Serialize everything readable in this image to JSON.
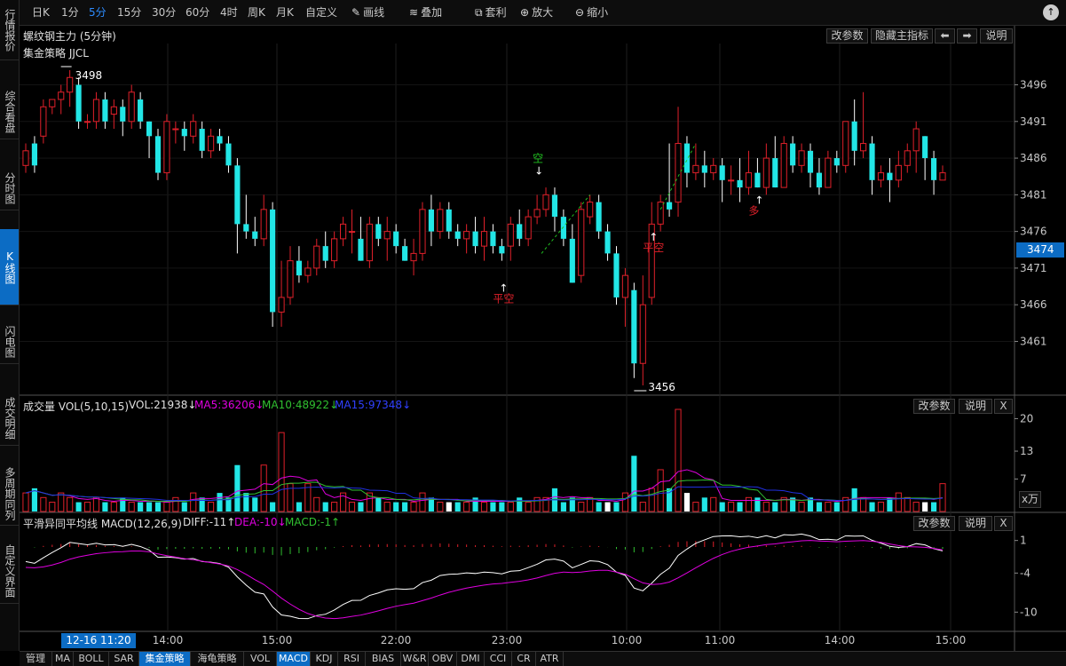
{
  "sidebar": {
    "items": [
      {
        "label": "行情报价",
        "active": false
      },
      {
        "label": "综合看盘",
        "active": false
      },
      {
        "label": "分时图",
        "active": false
      },
      {
        "label": "K线图",
        "active": true
      },
      {
        "label": "闪电图",
        "active": false
      },
      {
        "label": "成交明细",
        "active": false
      },
      {
        "label": "多周期同列",
        "active": false
      },
      {
        "label": "自定义界面",
        "active": false
      }
    ]
  },
  "toolbar": {
    "periods": [
      "日K",
      "1分",
      "5分",
      "15分",
      "30分",
      "60分",
      "4时",
      "周K",
      "月K",
      "自定义"
    ],
    "active_period": "5分",
    "tools": [
      {
        "label": "画线",
        "icon": "pencil-icon",
        "glyph": "✎"
      },
      {
        "label": "叠加",
        "icon": "stack-icon",
        "glyph": "≋"
      },
      {
        "label": "套利",
        "icon": "arbitrage-icon",
        "glyph": "⧉"
      },
      {
        "label": "放大",
        "icon": "zoom-in-icon",
        "glyph": "⊕"
      },
      {
        "label": "缩小",
        "icon": "zoom-out-icon",
        "glyph": "⊖"
      }
    ],
    "fullscreen_glyph": "↑"
  },
  "main_panel": {
    "title": "螺纹钢主力 (5分钟)",
    "strategy": "集金策略 JJCL",
    "buttons": [
      "改参数",
      "隐藏主指标",
      "⬅",
      "➡",
      "说明"
    ],
    "high_label": "3498",
    "low_label": "3456",
    "current_price": "3474",
    "price_ticks": [
      "3496",
      "3491",
      "3486",
      "3481",
      "3476",
      "3471",
      "3466",
      "3461"
    ],
    "signals": [
      {
        "text": "平空",
        "color": "#e0202a"
      },
      {
        "text": "空",
        "color": "#20c020"
      },
      {
        "text": "平空",
        "color": "#e0202a"
      },
      {
        "text": "多",
        "color": "#e0202a"
      }
    ]
  },
  "volume_panel": {
    "title": "成交量 VOL(5,10,15)",
    "vol": "VOL:21938",
    "ma5": "MA5:36206",
    "ma10": "MA10:48922",
    "ma15": "MA15:97348",
    "arrow": "↓",
    "buttons": [
      "改参数",
      "说明",
      "X"
    ],
    "ticks": [
      "20",
      "13",
      "7"
    ],
    "unit": "x万"
  },
  "macd_panel": {
    "title": "平滑异同平均线 MACD(12,26,9)",
    "diff": "DIFF:-11",
    "dea": "DEA:-10",
    "macd": "MACD:-1",
    "diff_arrow": "↑",
    "dea_arrow": "↓",
    "macd_arrow": "↑",
    "buttons": [
      "改参数",
      "说明",
      "X"
    ],
    "ticks": [
      "1",
      "-4",
      "-10"
    ]
  },
  "time_axis": {
    "cursor_label": "12-16 11:20",
    "labels": [
      "14:00",
      "15:00",
      "22:00",
      "23:00",
      "10:00",
      "11:00",
      "14:00",
      "15:00"
    ]
  },
  "bottom_tabs": {
    "items": [
      "管理",
      "MA",
      "BOLL",
      "SAR",
      "集金策略",
      "海龟策略",
      "VOL",
      "MACD",
      "KDJ",
      "RSI",
      "BIAS",
      "W&R",
      "OBV",
      "DMI",
      "CCI",
      "CR",
      "ATR"
    ],
    "active": [
      "集金策略",
      "MACD"
    ]
  },
  "colors": {
    "up": "#e0202a",
    "down": "#22e6e6",
    "ma5": "#e000e0",
    "ma10": "#30c030",
    "ma15": "#2030e0",
    "accent": "#0c6cc4"
  },
  "chart_data": {
    "type": "candlestick",
    "title": "螺纹钢主力 (5分钟)",
    "y_ticks": [
      3496,
      3491,
      3486,
      3481,
      3476,
      3471,
      3466,
      3461
    ],
    "ylim": [
      3455,
      3498
    ],
    "ohlc": [
      [
        3485,
        3487,
        3484,
        3488
      ],
      [
        3488,
        3485,
        3484,
        3489
      ],
      [
        3489,
        3493,
        3488,
        3494
      ],
      [
        3493,
        3494,
        3492,
        3494
      ],
      [
        3494,
        3495,
        3492,
        3496
      ],
      [
        3495,
        3497,
        3493,
        3498
      ],
      [
        3496,
        3491,
        3490,
        3497
      ],
      [
        3491,
        3491,
        3490,
        3492
      ],
      [
        3491,
        3494,
        3490,
        3495
      ],
      [
        3494,
        3491,
        3490,
        3495
      ],
      [
        3492,
        3493,
        3490,
        3494
      ],
      [
        3493,
        3491,
        3489,
        3494
      ],
      [
        3491,
        3495,
        3490,
        3496
      ],
      [
        3494,
        3491,
        3490,
        3495
      ],
      [
        3491,
        3489,
        3486,
        3491
      ],
      [
        3489,
        3484,
        3483,
        3490
      ],
      [
        3484,
        3491,
        3483,
        3492
      ],
      [
        3490,
        3490,
        3488,
        3491
      ],
      [
        3490,
        3489,
        3487,
        3491
      ],
      [
        3489,
        3491,
        3488,
        3492
      ],
      [
        3490,
        3487,
        3486,
        3491
      ],
      [
        3487,
        3489,
        3486,
        3490
      ],
      [
        3489,
        3488,
        3487,
        3490
      ],
      [
        3488,
        3485,
        3484,
        3489
      ],
      [
        3485,
        3477,
        3473,
        3486
      ],
      [
        3477,
        3476,
        3475,
        3481
      ],
      [
        3476,
        3475,
        3474,
        3478
      ],
      [
        3475,
        3479,
        3474,
        3481
      ],
      [
        3479,
        3465,
        3463,
        3480
      ],
      [
        3465,
        3467,
        3463,
        3472
      ],
      [
        3467,
        3472,
        3466,
        3474
      ],
      [
        3472,
        3470,
        3469,
        3474
      ],
      [
        3470,
        3471,
        3469,
        3472
      ],
      [
        3471,
        3474,
        3470,
        3475
      ],
      [
        3474,
        3472,
        3471,
        3476
      ],
      [
        3472,
        3475,
        3471,
        3476
      ],
      [
        3475,
        3477,
        3474,
        3478
      ],
      [
        3476,
        3476,
        3473,
        3479
      ],
      [
        3475,
        3472,
        3472,
        3478
      ],
      [
        3472,
        3477,
        3471,
        3478
      ],
      [
        3477,
        3475,
        3474,
        3478
      ],
      [
        3475,
        3476,
        3472,
        3478
      ],
      [
        3476,
        3474,
        3473,
        3477
      ],
      [
        3474,
        3472,
        3472,
        3475
      ],
      [
        3472,
        3473,
        3470,
        3475
      ],
      [
        3473,
        3479,
        3472,
        3480
      ],
      [
        3479,
        3476,
        3474,
        3481
      ],
      [
        3476,
        3479,
        3475,
        3480
      ],
      [
        3479,
        3476,
        3475,
        3480
      ],
      [
        3476,
        3475,
        3474,
        3477
      ],
      [
        3475,
        3476,
        3473,
        3477
      ],
      [
        3476,
        3474,
        3473,
        3478
      ],
      [
        3474,
        3476,
        3472,
        3478
      ],
      [
        3476,
        3474,
        3473,
        3477
      ],
      [
        3474,
        3473,
        3472,
        3475
      ],
      [
        3474,
        3477,
        3472,
        3478
      ],
      [
        3477,
        3475,
        3474,
        3479
      ],
      [
        3475,
        3478,
        3474,
        3479
      ],
      [
        3478,
        3479,
        3477,
        3481
      ],
      [
        3479,
        3481,
        3478,
        3482
      ],
      [
        3481,
        3478,
        3476,
        3482
      ],
      [
        3478,
        3475,
        3474,
        3479
      ],
      [
        3475,
        3469,
        3469,
        3477
      ],
      [
        3470,
        3479,
        3469,
        3480
      ],
      [
        3478,
        3480,
        3477,
        3481
      ],
      [
        3480,
        3476,
        3475,
        3481
      ],
      [
        3476,
        3473,
        3472,
        3477
      ],
      [
        3473,
        3467,
        3466,
        3474
      ],
      [
        3467,
        3470,
        3463,
        3471
      ],
      [
        3468,
        3458,
        3456,
        3469
      ],
      [
        3458,
        3466,
        3455,
        3470
      ],
      [
        3467,
        3477,
        3466,
        3480
      ],
      [
        3477,
        3480,
        3476,
        3481
      ],
      [
        3480,
        3479,
        3478,
        3488
      ],
      [
        3480,
        3488,
        3478,
        3493
      ],
      [
        3488,
        3484,
        3482,
        3489
      ],
      [
        3484,
        3485,
        3483,
        3488
      ],
      [
        3485,
        3484,
        3482,
        3487
      ],
      [
        3484,
        3485,
        3483,
        3486
      ],
      [
        3485,
        3483,
        3480,
        3486
      ],
      [
        3483,
        3483,
        3481,
        3485
      ],
      [
        3483,
        3482,
        3480,
        3486
      ],
      [
        3482,
        3484,
        3481,
        3487
      ],
      [
        3484,
        3482,
        3482,
        3486
      ],
      [
        3482,
        3486,
        3481,
        3488
      ],
      [
        3486,
        3482,
        3482,
        3489
      ],
      [
        3482,
        3488,
        3482,
        3489
      ],
      [
        3488,
        3485,
        3484,
        3489
      ],
      [
        3485,
        3487,
        3484,
        3488
      ],
      [
        3487,
        3484,
        3482,
        3488
      ],
      [
        3484,
        3482,
        3481,
        3486
      ],
      [
        3482,
        3486,
        3482,
        3487
      ],
      [
        3486,
        3485,
        3484,
        3487
      ],
      [
        3485,
        3491,
        3484,
        3491
      ],
      [
        3491,
        3487,
        3485,
        3494
      ],
      [
        3487,
        3488,
        3486,
        3495
      ],
      [
        3488,
        3483,
        3481,
        3489
      ],
      [
        3483,
        3484,
        3482,
        3485
      ],
      [
        3484,
        3483,
        3480,
        3486
      ],
      [
        3483,
        3485,
        3482,
        3487
      ],
      [
        3485,
        3487,
        3484,
        3488
      ],
      [
        3487,
        3490,
        3484,
        3491
      ],
      [
        3489,
        3486,
        3483,
        3489
      ],
      [
        3486,
        3483,
        3481,
        3487
      ],
      [
        3483,
        3484,
        3483,
        3485
      ]
    ],
    "volume": [
      4,
      5,
      3,
      2,
      4,
      3,
      2,
      2,
      3,
      2,
      2,
      3,
      2,
      2,
      2,
      2,
      2,
      3,
      2,
      4,
      3,
      2,
      4,
      3,
      10,
      4,
      3,
      10,
      2,
      17,
      6,
      2,
      6,
      3,
      2,
      2,
      4,
      2,
      2,
      4,
      3,
      2,
      2,
      2,
      2,
      4,
      3,
      2,
      2,
      2,
      2,
      3,
      2,
      2,
      2,
      2,
      3,
      2,
      3,
      3,
      5,
      2,
      3,
      2,
      3,
      2,
      2,
      2,
      4,
      12,
      2,
      5,
      9,
      5,
      22,
      4,
      2,
      3,
      3,
      2,
      2,
      2,
      3,
      3,
      2,
      2,
      3,
      3,
      2,
      3,
      2,
      2,
      2,
      3,
      5,
      3,
      2,
      2,
      3,
      4,
      3,
      2,
      2,
      2,
      6
    ],
    "macd_ticks": [
      1,
      -4,
      -10
    ]
  }
}
